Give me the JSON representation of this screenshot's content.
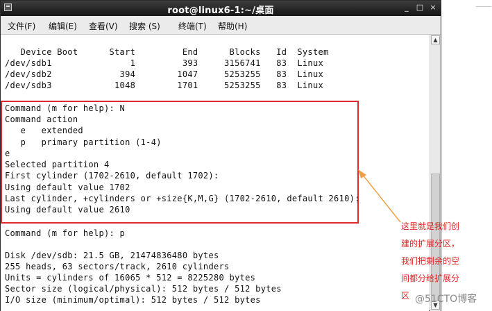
{
  "window": {
    "title": "root@linux6-1:~/桌面",
    "controls": {
      "minimize": "_",
      "maximize": "□",
      "close": "×"
    }
  },
  "menu": {
    "items": [
      "文件(F)",
      "编辑(E)",
      "查看(V)",
      "搜索 (S)",
      "终端(T)",
      "帮助(H)"
    ]
  },
  "terminal": {
    "lines": [
      "",
      "   Device Boot      Start         End      Blocks   Id  System",
      "/dev/sdb1               1         393     3156741   83  Linux",
      "/dev/sdb2             394        1047     5253255   83  Linux",
      "/dev/sdb3            1048        1701     5253255   83  Linux",
      "",
      "Command (m for help): N",
      "Command action",
      "   e   extended",
      "   p   primary partition (1-4)",
      "e",
      "Selected partition 4",
      "First cylinder (1702-2610, default 1702):",
      "Using default value 1702",
      "Last cylinder, +cylinders or +size{K,M,G} (1702-2610, default 2610):",
      "Using default value 2610",
      "",
      "Command (m for help): p",
      "",
      "Disk /dev/sdb: 21.5 GB, 21474836480 bytes",
      "255 heads, 63 sectors/track, 2610 cylinders",
      "Units = cylinders of 16065 * 512 = 8225280 bytes",
      "Sector size (logical/physical): 512 bytes / 512 bytes",
      "I/O size (minimum/optimal): 512 bytes / 512 bytes"
    ]
  },
  "annotation": {
    "lines": [
      "这里就是我们创",
      "建的扩展分区，",
      "我们把剩余的空",
      "间都分给扩展分",
      "区"
    ]
  },
  "watermark": "@51CTO博客",
  "colors": {
    "highlight": "#e0282f",
    "arrow": "#f0a04a",
    "annotation_text": "#e02525",
    "titlebar": "#1f1f1f"
  }
}
